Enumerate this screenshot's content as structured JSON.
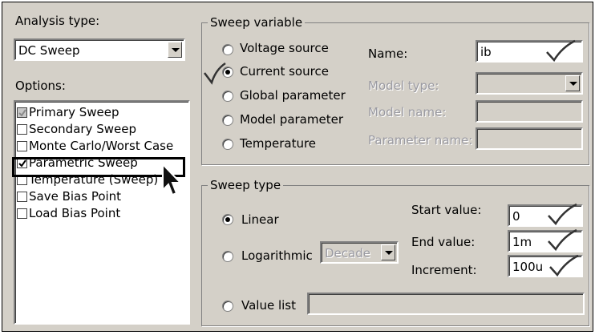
{
  "analysis": {
    "label": "Analysis type:",
    "selected": "DC Sweep"
  },
  "options": {
    "label": "Options:",
    "items": [
      {
        "label": "Primary Sweep",
        "checked": true,
        "disabled": true
      },
      {
        "label": "Secondary Sweep",
        "checked": false
      },
      {
        "label": "Monte Carlo/Worst Case",
        "checked": false
      },
      {
        "label": "Parametric Sweep",
        "checked": true
      },
      {
        "label": "Temperature (Sweep)",
        "checked": false
      },
      {
        "label": "Save Bias Point",
        "checked": false
      },
      {
        "label": "Load Bias Point",
        "checked": false
      }
    ]
  },
  "sweep_variable": {
    "title": "Sweep variable",
    "radios": [
      "Voltage source",
      "Current source",
      "Global parameter",
      "Model parameter",
      "Temperature"
    ],
    "selected": "Current source",
    "name_label": "Name:",
    "name_value": "ib",
    "model_type_label": "Model type:",
    "model_name_label": "Model name:",
    "parameter_name_label": "Parameter name:"
  },
  "sweep_type": {
    "title": "Sweep type",
    "linear_label": "Linear",
    "log_label": "Logarithmic",
    "log_option": "Decade",
    "value_list_label": "Value list",
    "selected": "Linear",
    "start_label": "Start value:",
    "start_value": "0",
    "end_label": "End value:",
    "end_value": "1m",
    "increment_label": "Increment:",
    "increment_value": "100u"
  },
  "colors": {
    "dialog_bg": "#d4d0c8",
    "annotation": "#333333"
  }
}
